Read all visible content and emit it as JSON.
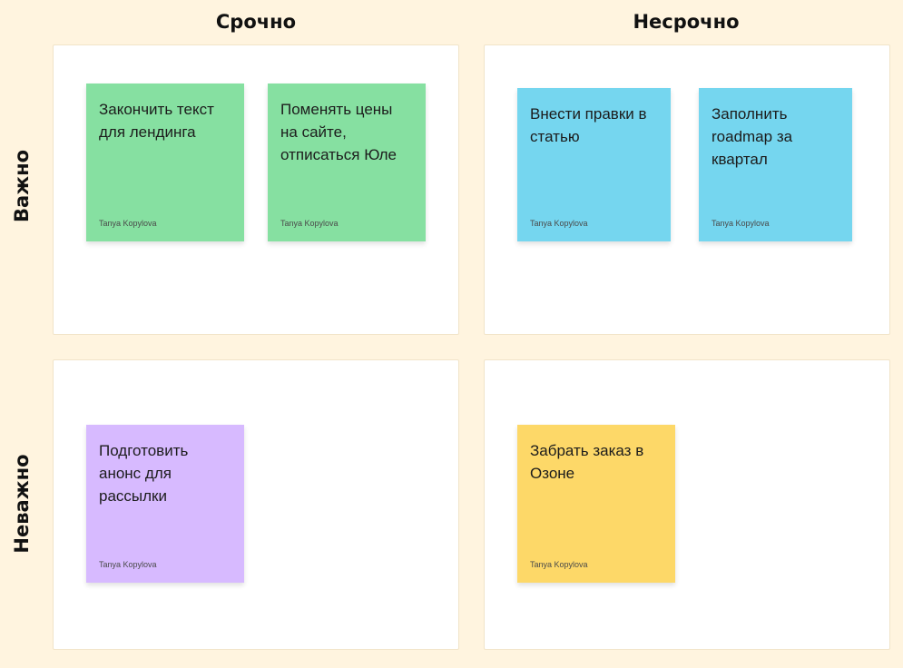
{
  "columns": {
    "urgent": "Срочно",
    "not_urgent": "Несрочно"
  },
  "rows": {
    "important": "Важно",
    "not_important": "Неважно"
  },
  "colors": {
    "background": "#fff4df",
    "green": "#86e0a1",
    "blue": "#75d6ef",
    "purple": "#d7baff",
    "yellow": "#fdd868"
  },
  "notes": [
    {
      "text": "Закончить текст для лендинга",
      "author": "Tanya Kopylova"
    },
    {
      "text": "Поменять цены на сайте, отписаться Юле",
      "author": "Tanya Kopylova"
    },
    {
      "text": "Внести правки в статью",
      "author": "Tanya Kopylova"
    },
    {
      "text": "Заполнить roadmap за квартал",
      "author": "Tanya Kopylova"
    },
    {
      "text": "Подготовить анонс для рассылки",
      "author": "Tanya Kopylova"
    },
    {
      "text": "Забрать заказ в Озоне",
      "author": "Tanya Kopylova"
    }
  ]
}
